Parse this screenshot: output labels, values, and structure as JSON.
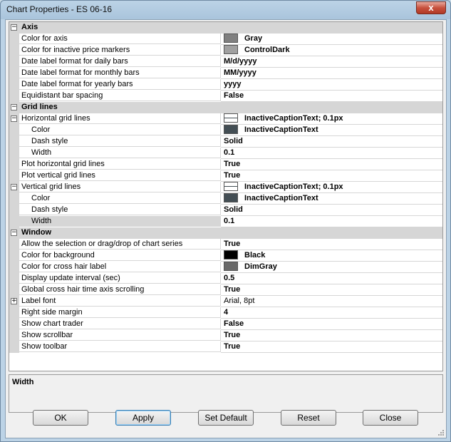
{
  "window": {
    "title": "Chart Properties - ES 06-16",
    "close_glyph": "x"
  },
  "rows": [
    {
      "type": "cat",
      "label": "Axis",
      "toggle": "−"
    },
    {
      "type": "prop",
      "label": "Color for axis",
      "value": "Gray",
      "swatch": "#808080"
    },
    {
      "type": "prop",
      "label": "Color for inactive price markers",
      "value": "ControlDark",
      "swatch": "#a0a0a0"
    },
    {
      "type": "prop",
      "label": "Date label format for daily bars",
      "value": "M/d/yyyy"
    },
    {
      "type": "prop",
      "label": "Date label format for monthly bars",
      "value": "MM/yyyy"
    },
    {
      "type": "prop",
      "label": "Date label format for yearly bars",
      "value": "yyyy"
    },
    {
      "type": "prop",
      "label": "Equidistant bar spacing",
      "value": "False"
    },
    {
      "type": "cat",
      "label": "Grid lines",
      "toggle": "−"
    },
    {
      "type": "prop",
      "label": "Horizontal grid lines",
      "value": "InactiveCaptionText; 0.1px",
      "toggle": "−",
      "linebox": true
    },
    {
      "type": "child",
      "label": "Color",
      "value": "InactiveCaptionText",
      "swatch": "#434e54"
    },
    {
      "type": "child",
      "label": "Dash style",
      "value": "Solid"
    },
    {
      "type": "child",
      "label": "Width",
      "value": "0.1"
    },
    {
      "type": "prop",
      "label": "Plot horizontal grid lines",
      "value": "True"
    },
    {
      "type": "prop",
      "label": "Plot vertical grid lines",
      "value": "True"
    },
    {
      "type": "prop",
      "label": "Vertical grid lines",
      "value": "InactiveCaptionText; 0.1px",
      "toggle": "−",
      "linebox": true
    },
    {
      "type": "child",
      "label": "Color",
      "value": "InactiveCaptionText",
      "swatch": "#434e54"
    },
    {
      "type": "child",
      "label": "Dash style",
      "value": "Solid"
    },
    {
      "type": "child",
      "label": "Width",
      "value": "0.1",
      "selected": true
    },
    {
      "type": "cat",
      "label": "Window",
      "toggle": "−"
    },
    {
      "type": "prop",
      "label": "Allow the selection or drag/drop of chart series",
      "value": "True"
    },
    {
      "type": "prop",
      "label": "Color for background",
      "value": "Black",
      "swatch": "#000000"
    },
    {
      "type": "prop",
      "label": "Color for cross hair label",
      "value": "DimGray",
      "swatch": "#696969"
    },
    {
      "type": "prop",
      "label": "Display update interval (sec)",
      "value": "0.5"
    },
    {
      "type": "prop",
      "label": "Global cross hair time axis scrolling",
      "value": "True"
    },
    {
      "type": "prop",
      "label": "Label font",
      "value": "Arial, 8pt",
      "toggle": "+",
      "normal": true
    },
    {
      "type": "prop",
      "label": "Right side margin",
      "value": "4"
    },
    {
      "type": "prop",
      "label": "Show chart trader",
      "value": "False"
    },
    {
      "type": "prop",
      "label": "Show scrollbar",
      "value": "True"
    },
    {
      "type": "prop",
      "label": "Show toolbar",
      "value": "True"
    }
  ],
  "description": {
    "title": "Width"
  },
  "buttons": {
    "ok": "OK",
    "apply": "Apply",
    "set_default": "Set Default",
    "reset": "Reset",
    "close": "Close"
  }
}
